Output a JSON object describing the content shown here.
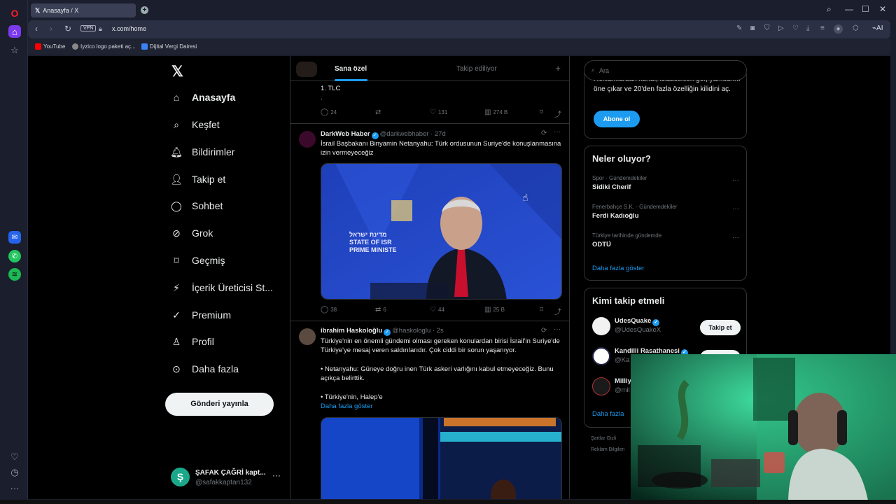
{
  "browser": {
    "tab_title": "Anasayfa / X",
    "url": "x.com/home",
    "vpn_label": "VPN",
    "ai_label": "AI",
    "bookmarks": [
      {
        "label": "YouTube",
        "color": "#ff0000"
      },
      {
        "label": "Iyzico logo paketi aç...",
        "color": "#888888"
      },
      {
        "label": "Dijital Vergi Dairesi",
        "color": "#3b82f6"
      }
    ]
  },
  "leftnav": {
    "items": [
      {
        "label": "Anasayfa",
        "icon": "home-icon"
      },
      {
        "label": "Keşfet",
        "icon": "search-icon"
      },
      {
        "label": "Bildirimler",
        "icon": "bell-icon"
      },
      {
        "label": "Takip et",
        "icon": "person-add-icon"
      },
      {
        "label": "Sohbet",
        "icon": "chat-icon"
      },
      {
        "label": "Grok",
        "icon": "grok-icon"
      },
      {
        "label": "Geçmiş",
        "icon": "bookmark-icon"
      },
      {
        "label": "İçerik Üreticisi St...",
        "icon": "lightning-icon"
      },
      {
        "label": "Premium",
        "icon": "premium-icon"
      },
      {
        "label": "Profil",
        "icon": "profile-icon"
      },
      {
        "label": "Daha fazla",
        "icon": "more-icon"
      }
    ],
    "post_button": "Gönderi yayınla",
    "account": {
      "avatar_letter": "Ş",
      "name": "ŞAFAK ÇAĞRİ kapt...",
      "handle": "@safakkaptan132"
    }
  },
  "feed": {
    "tabs": {
      "for_you": "Sana özel",
      "following": "Takip ediliyor"
    },
    "tweets": [
      {
        "text": "1. TLC\n.",
        "replies": "24",
        "reposts": "",
        "likes": "131",
        "views": "274 B"
      },
      {
        "name": "DarkWeb Haber",
        "handle": "@darkwebhaber",
        "time": "· 27d",
        "text": "İsrail Başbakanı Binyamin Netanyahu: Türk ordusunun Suriye'de konuşlanmasına izin vermeyeceğiz",
        "replies": "38",
        "reposts": "6",
        "likes": "44",
        "views": "25 B",
        "media_sign": "מדינת ישראל\nSTATE OF ISR\nPRIME MINISTE"
      },
      {
        "name": "ibrahim Haskoloğlu",
        "handle": "@haskologlu",
        "time": "· 2s",
        "text": "Türkiye'nin en önemli gündemi olması gereken konulardan birisi İsrail'in Suriye'de Türkiye'ye mesaj veren saldırılarıdır. Çok ciddi bir sorun yaşanıyor.\n\n• Netanyahu:  Güneye doğru inen Türk askeri varlığını kabul etmeyeceğiz. Bunu açıkça belirttik.\n\n• Türkiye'nin, Halep'e",
        "more": "Daha fazla göster"
      }
    ]
  },
  "right": {
    "search_placeholder": "Ara",
    "premium_text": "Reklamlardan kurtul, istatistikleri gör, yanıtlarını öne çıkar ve 20'den fazla özelliğin kilidini aç.",
    "subscribe_button": "Abone ol",
    "trends_title": "Neler oluyor?",
    "trends": [
      {
        "context": "Spor · Gündemdekiler",
        "title": "Sidiki Cherif"
      },
      {
        "context": "Fenerbahçe S.K. · Gündemdekiler",
        "title": "Ferdi Kadıoğlu"
      },
      {
        "context": "Türkiye tarihinde gündemde",
        "title": "ODTÜ"
      }
    ],
    "show_more": "Daha fazla göster",
    "who_title": "Kimi takip etmeli",
    "who": [
      {
        "name": "UdesQuake",
        "handle": "@UdesQuakeX",
        "button": "Takip et"
      },
      {
        "name": "Kandilli Rasathanesi",
        "handle": "@Ka",
        "button": "Takip et"
      },
      {
        "name": "Milliy",
        "handle": "@mil",
        "button": ""
      }
    ],
    "who_more": "Daha fazla",
    "footer_line1": "Şartlar   Gizli",
    "footer_line2": "Reklam Bilgileri"
  },
  "colors": {
    "accent": "#1d9bf0",
    "background": "#000000",
    "text": "#e7e9ea",
    "muted": "#71767b"
  }
}
